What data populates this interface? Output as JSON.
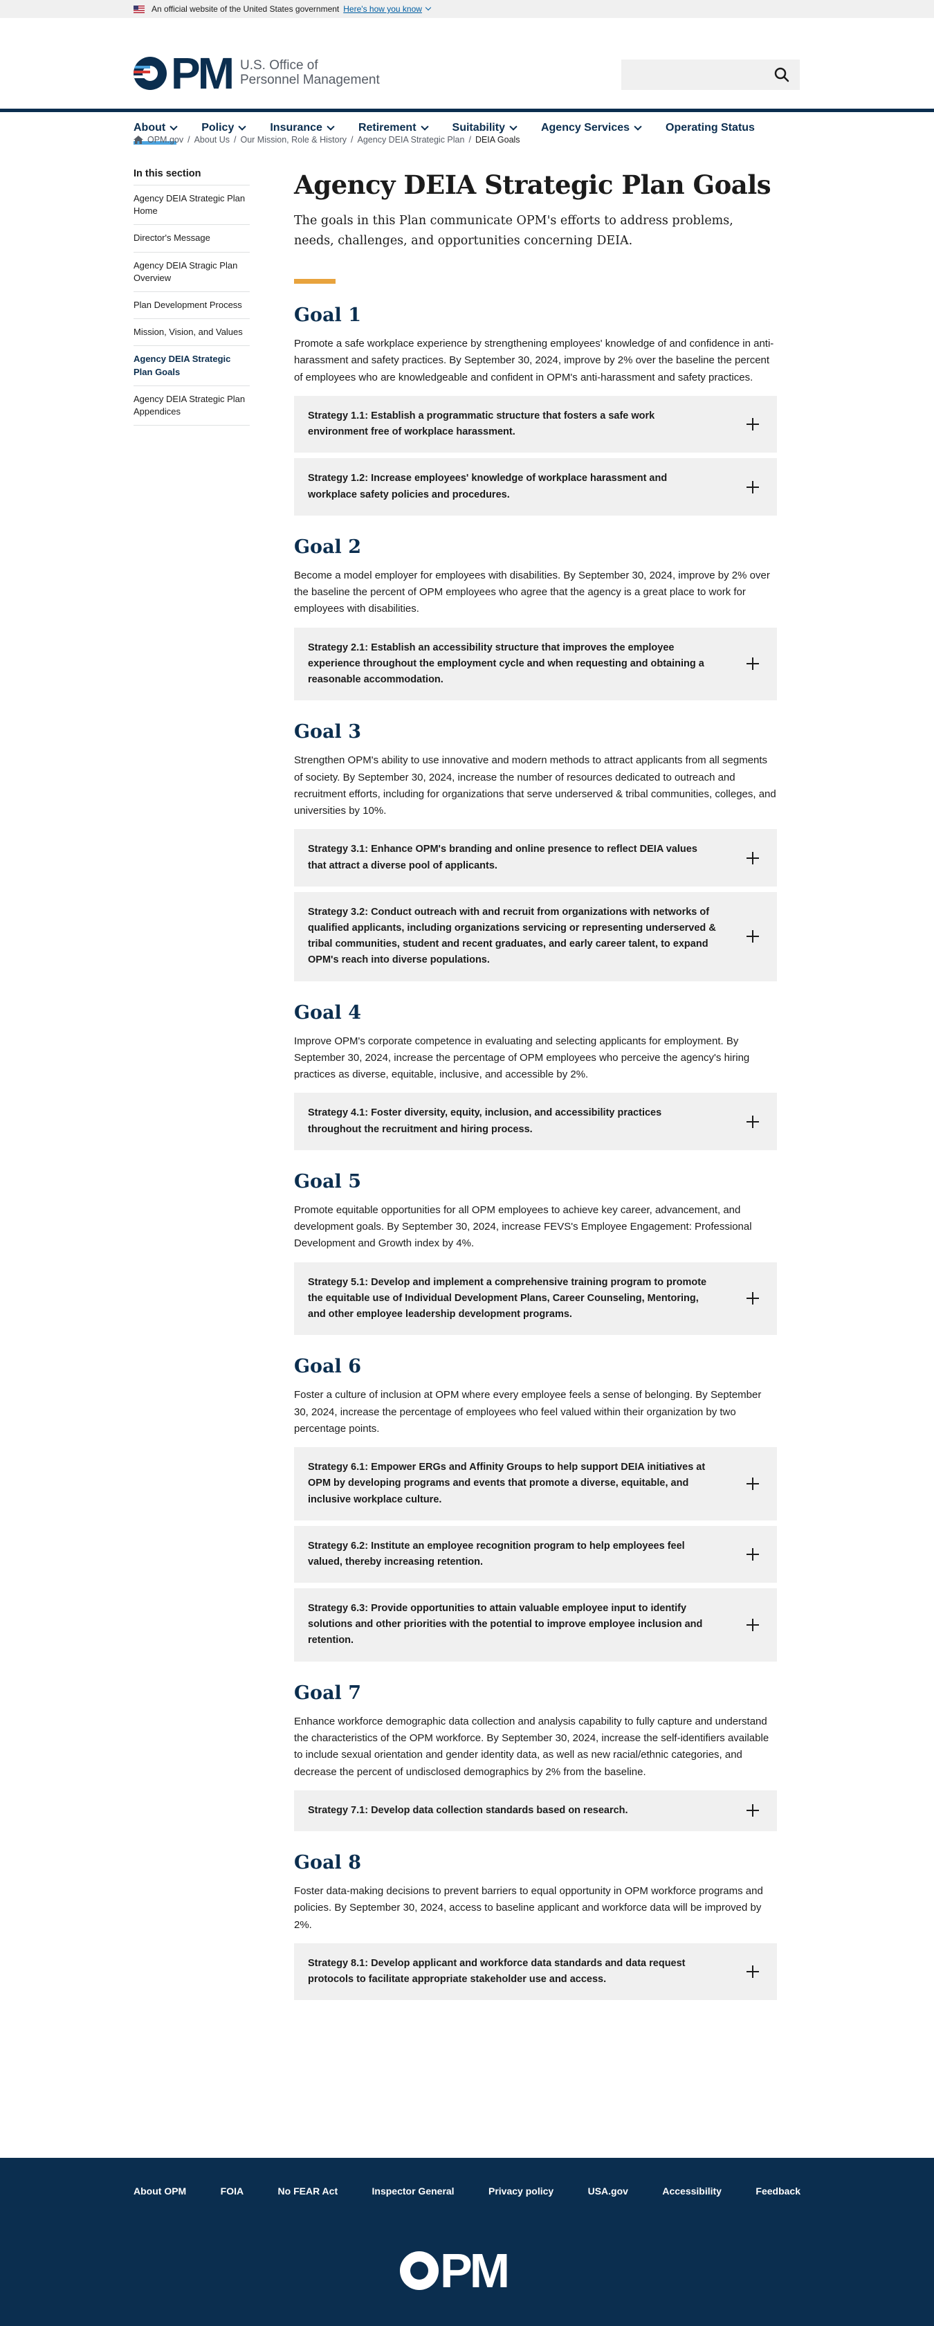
{
  "gov_banner": {
    "text": "An official website of the United States government",
    "link": "Here's how you know"
  },
  "logo": {
    "letters": "PM",
    "line1": "U.S. Office of",
    "line2": "Personnel Management"
  },
  "search": {
    "placeholder": ""
  },
  "nav": [
    {
      "label": "About"
    },
    {
      "label": "Policy"
    },
    {
      "label": "Insurance"
    },
    {
      "label": "Retirement"
    },
    {
      "label": "Suitability"
    },
    {
      "label": "Agency Services"
    },
    {
      "label": "Operating Status"
    }
  ],
  "breadcrumb": [
    "OPM.gov",
    "About Us",
    "Our Mission, Role & History",
    "Agency DEIA Strategic Plan",
    "DEIA Goals"
  ],
  "sidebar": {
    "heading": "In this section",
    "items": [
      "Agency DEIA Strategic Plan Home",
      "Director's Message",
      "Agency DEIA Stragic Plan Overview",
      "Plan Development Process",
      "Mission, Vision, and Values",
      "Agency DEIA Strategic Plan Goals",
      "Agency DEIA Strategic Plan Appendices"
    ]
  },
  "main": {
    "title": "Agency DEIA Strategic Plan Goals",
    "intro": "The goals in this Plan communicate OPM's efforts to address problems, needs, challenges, and opportunities concerning DEIA.",
    "goals": [
      {
        "title": "Goal 1",
        "text": "Promote a safe workplace experience by strengthening employees' knowledge of and confidence in anti-harassment and safety practices. By September 30, 2024, improve by 2% over the baseline the percent of employees who are knowledgeable and confident in OPM's anti-harassment and safety practices.",
        "strategies": [
          "Strategy 1.1: Establish a programmatic structure that fosters a safe work environment free of workplace harassment.",
          "Strategy 1.2: Increase employees' knowledge of workplace harassment and workplace safety policies and procedures."
        ]
      },
      {
        "title": "Goal 2",
        "text": "Become a model employer for employees with disabilities. By September 30, 2024, improve by 2% over the baseline the percent of OPM employees who agree that the agency is a great place to work for employees with disabilities.",
        "strategies": [
          "Strategy 2.1: Establish an accessibility structure that improves the employee experience throughout the employment cycle and when requesting and obtaining a reasonable accommodation."
        ]
      },
      {
        "title": "Goal 3",
        "text": "Strengthen OPM's ability to use innovative and modern methods to attract applicants from all segments of society. By September 30, 2024, increase the number of resources dedicated to outreach and recruitment efforts, including for organizations that serve underserved & tribal communities, colleges, and universities by 10%.",
        "strategies": [
          "Strategy 3.1: Enhance OPM's branding and online presence to reflect DEIA values that attract a diverse pool of applicants.",
          "Strategy 3.2: Conduct outreach with and recruit from organizations with networks of qualified applicants, including organizations servicing or representing underserved & tribal communities, student and recent graduates, and early career talent, to expand OPM's reach into diverse populations."
        ]
      },
      {
        "title": "Goal 4",
        "text": "Improve OPM's corporate competence in evaluating and selecting applicants for employment. By September 30, 2024, increase the percentage of OPM employees who perceive the agency's hiring practices as diverse, equitable, inclusive, and accessible by 2%.",
        "strategies": [
          "Strategy 4.1: Foster diversity, equity, inclusion, and accessibility practices throughout the recruitment and hiring process."
        ]
      },
      {
        "title": "Goal 5",
        "text": "Promote equitable opportunities for all OPM employees to achieve key career, advancement, and development goals. By September 30, 2024, increase FEVS's Employee Engagement: Professional Development and Growth index by 4%.",
        "strategies": [
          "Strategy 5.1: Develop and implement a comprehensive training program to promote the equitable use of Individual Development Plans, Career Counseling, Mentoring, and other employee leadership development programs."
        ]
      },
      {
        "title": "Goal 6",
        "text": "Foster a culture of inclusion at OPM where every employee feels a sense of belonging. By September 30, 2024, increase the percentage of employees who feel valued within their organization by two percentage points.",
        "strategies": [
          "Strategy 6.1: Empower ERGs and Affinity Groups to help support DEIA initiatives at OPM by developing programs and events that promote a diverse, equitable, and inclusive workplace culture.",
          "Strategy 6.2: Institute an employee recognition program to help employees feel valued, thereby increasing retention.",
          "Strategy 6.3: Provide opportunities to attain valuable employee input to identify solutions and other priorities with the potential to improve employee inclusion and retention."
        ]
      },
      {
        "title": "Goal 7",
        "text": "Enhance workforce demographic data collection and analysis capability to fully capture and understand the characteristics of the OPM workforce. By September 30, 2024, increase the self-identifiers available to include sexual orientation and gender identity data, as well as new racial/ethnic categories, and decrease the percent of undisclosed demographics by 2% from the baseline.",
        "strategies": [
          "Strategy 7.1: Develop data collection standards based on research."
        ]
      },
      {
        "title": "Goal 8",
        "text": "Foster data-making decisions to prevent barriers to equal opportunity in OPM workforce programs and policies. By September 30, 2024, access to baseline applicant and workforce data will be improved by 2%.",
        "strategies": [
          "Strategy 8.1: Develop applicant and workforce data standards and data request protocols to facilitate appropriate stakeholder use and access."
        ]
      }
    ]
  },
  "footer": {
    "links": [
      "About OPM",
      "FOIA",
      "No FEAR Act",
      "Inspector General",
      "Privacy policy",
      "USA.gov",
      "Accessibility",
      "Feedback"
    ],
    "logo_letters": "PM"
  },
  "colors": {
    "navy": "#0b2e4f",
    "accent": "#e8a33d",
    "highlight": "#4aa3df"
  }
}
